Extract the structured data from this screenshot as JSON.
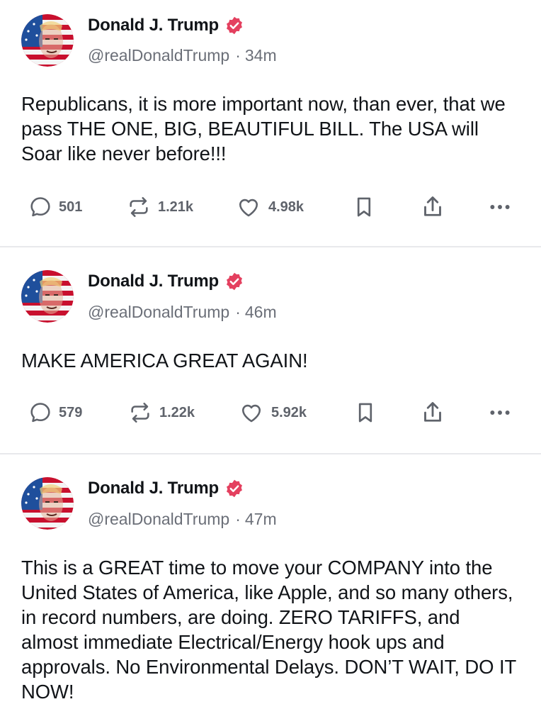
{
  "colors": {
    "text": "#111418",
    "muted": "#6b6f78",
    "icon": "#5f636b",
    "verified": "#e4405f",
    "divider": "#e8e9ec"
  },
  "posts": [
    {
      "author": {
        "name": "Donald J. Trump",
        "handle": "@realDonaldTrump",
        "verified": true,
        "avatar": "user-avatar-flag-portrait"
      },
      "time": "34m",
      "text": "Republicans, it is more important now, than ever, that we pass THE ONE, BIG, BEAUTIFUL BILL. The USA will Soar like never before!!!",
      "stats": {
        "replies": "501",
        "reposts": "1.21k",
        "likes": "4.98k"
      }
    },
    {
      "author": {
        "name": "Donald J. Trump",
        "handle": "@realDonaldTrump",
        "verified": true,
        "avatar": "user-avatar-flag-portrait"
      },
      "time": "46m",
      "text": "MAKE AMERICA GREAT AGAIN!",
      "stats": {
        "replies": "579",
        "reposts": "1.22k",
        "likes": "5.92k"
      }
    },
    {
      "author": {
        "name": "Donald J. Trump",
        "handle": "@realDonaldTrump",
        "verified": true,
        "avatar": "user-avatar-flag-portrait"
      },
      "time": "47m",
      "text": "This is a GREAT time to move your COMPANY into the United States of America, like Apple, and so many others, in record numbers, are doing. ZERO TARIFFS, and almost immediate Electrical/Energy hook ups and approvals. No Environmental Delays. DON’T WAIT, DO IT NOW!"
    }
  ],
  "icons": {
    "reply": "speech-bubble-icon",
    "repost": "repost-arrows-icon",
    "like": "heart-icon",
    "bookmark": "bookmark-icon",
    "share": "share-upload-icon",
    "more": "more-dots-icon",
    "verified": "verified-badge-icon"
  }
}
